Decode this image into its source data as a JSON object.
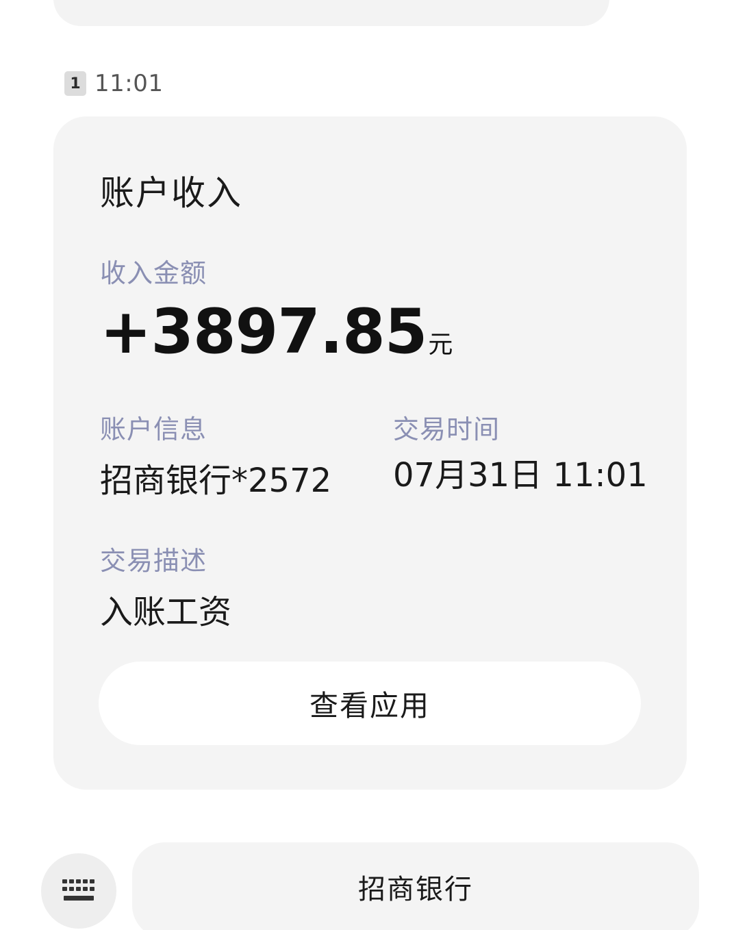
{
  "message": {
    "sim_slot": "1",
    "time": "11:01"
  },
  "card": {
    "title": "账户收入",
    "amount_label": "收入金额",
    "amount": "+3897.85",
    "amount_unit": "元",
    "account_label": "账户信息",
    "account_value": "招商银行*2572",
    "time_label": "交易时间",
    "time_value": "07月31日 11:01",
    "desc_label": "交易描述",
    "desc_value": "入账工资",
    "action_label": "查看应用"
  },
  "bottom_bar": {
    "keyboard_icon": "keyboard-icon",
    "menu_label": "招商银行"
  },
  "colors": {
    "card_bg": "#f4f4f4",
    "label": "#8a8fb3",
    "text": "#1a1a1a"
  }
}
